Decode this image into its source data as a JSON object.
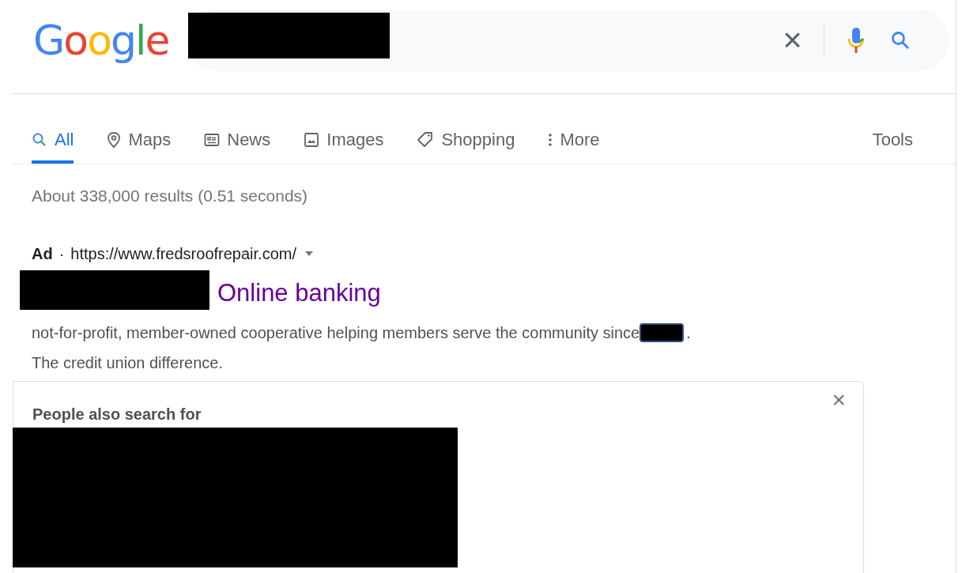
{
  "logo": "Google",
  "search": {
    "buttons": [
      {
        "kind": "clear",
        "label": "×"
      },
      {
        "kind": "voice"
      },
      {
        "kind": "search"
      }
    ]
  },
  "tabs": [
    {
      "label": "All",
      "kind": "search",
      "selected": true
    },
    {
      "label": "Maps",
      "kind": "pin",
      "selected": false
    },
    {
      "label": "News",
      "kind": "news",
      "selected": false
    },
    {
      "label": "Images",
      "kind": "image",
      "selected": false
    },
    {
      "label": "Shopping",
      "kind": "tag",
      "selected": false
    },
    {
      "label": "More",
      "kind": "more",
      "selected": false
    }
  ],
  "tools": "Tools",
  "result_stats": "About 338,000 results (0.51 seconds)",
  "ad": {
    "badge": "Ad",
    "separator": "·",
    "url": "https://www.fredsroofrepair.com/",
    "title": "Online banking",
    "snippet_start": "not-for-profit, member-owned cooperative helping members serve the community since",
    "snippet_end": ".",
    "snippet_line_2": "The credit union difference."
  },
  "people_also_search": {
    "title": "People also search for",
    "close": "×"
  }
}
